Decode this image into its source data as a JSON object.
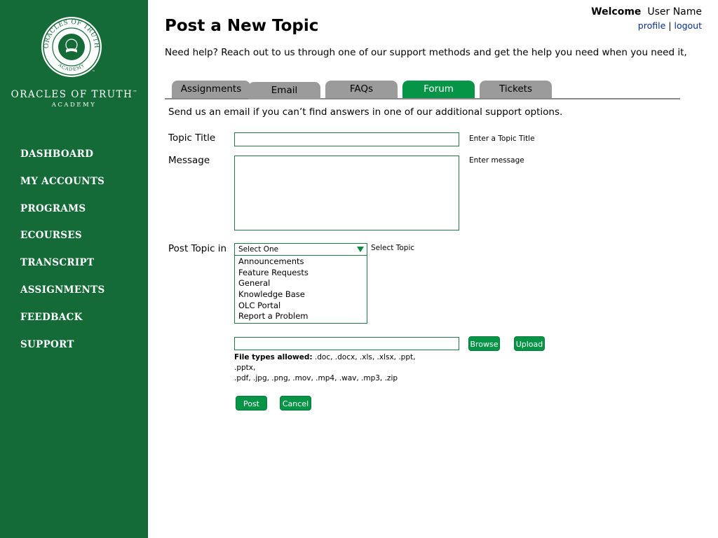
{
  "brand": {
    "name": "ORACLES OF TRUTH",
    "tm": "™",
    "sub": "ACADEMY",
    "seal_ring_text": "ORACLES OF TRUTH",
    "seal_bottom_text": "ACADEMY",
    "seal_tm": "™"
  },
  "sidebar": {
    "items": [
      {
        "label": "DASHBOARD"
      },
      {
        "label": "MY ACCOUNTS"
      },
      {
        "label": "PROGRAMS"
      },
      {
        "label": "ECOURSES"
      },
      {
        "label": "TRANSCRIPT"
      },
      {
        "label": "ASSIGNMENTS"
      },
      {
        "label": "FEEDBACK"
      },
      {
        "label": "SUPPORT"
      }
    ]
  },
  "header": {
    "welcome": "Welcome",
    "user_name": "User Name",
    "profile": "profile",
    "separator": "|",
    "logout": "logout"
  },
  "page": {
    "title": "Post a New Topic",
    "help_text": "Need help? Reach out to us through one of our support methods and get the help you need when you need it,"
  },
  "tabs": [
    {
      "label": "Assignments",
      "active": false
    },
    {
      "label": "Email",
      "active": false
    },
    {
      "label": "FAQs",
      "active": false
    },
    {
      "label": "Forum",
      "active": true
    },
    {
      "label": "Tickets",
      "active": false
    }
  ],
  "form": {
    "intro": "Send us an email if you can’t find answers in one of our additional support options.",
    "topic_title": {
      "label": "Topic Title",
      "hint": "Enter a Topic Title",
      "value": ""
    },
    "message": {
      "label": "Message",
      "hint": "Enter message",
      "value": ""
    },
    "post_in": {
      "label": "Post Topic in",
      "selected": "Select One",
      "hint": "Select Topic",
      "options": [
        "Announcements",
        "Feature Requests",
        "General",
        "Knowledge Base",
        "OLC Portal",
        "Report a Problem"
      ]
    },
    "file": {
      "value": "",
      "browse": "Browse",
      "upload": "Upload",
      "types_label": "File types allowed:",
      "types_line1": " .doc, .docx, .xls, .xlsx, .ppt, .pptx,",
      "types_line2": ".pdf, .jpg, .png, .mov, .mp4, .wav, .mp3, .zip"
    },
    "post": "Post",
    "cancel": "Cancel"
  },
  "colors": {
    "sidebar": "#156b38",
    "accent": "#069447",
    "tab_inactive": "#9b9b9b",
    "link": "#0b2e8c"
  }
}
